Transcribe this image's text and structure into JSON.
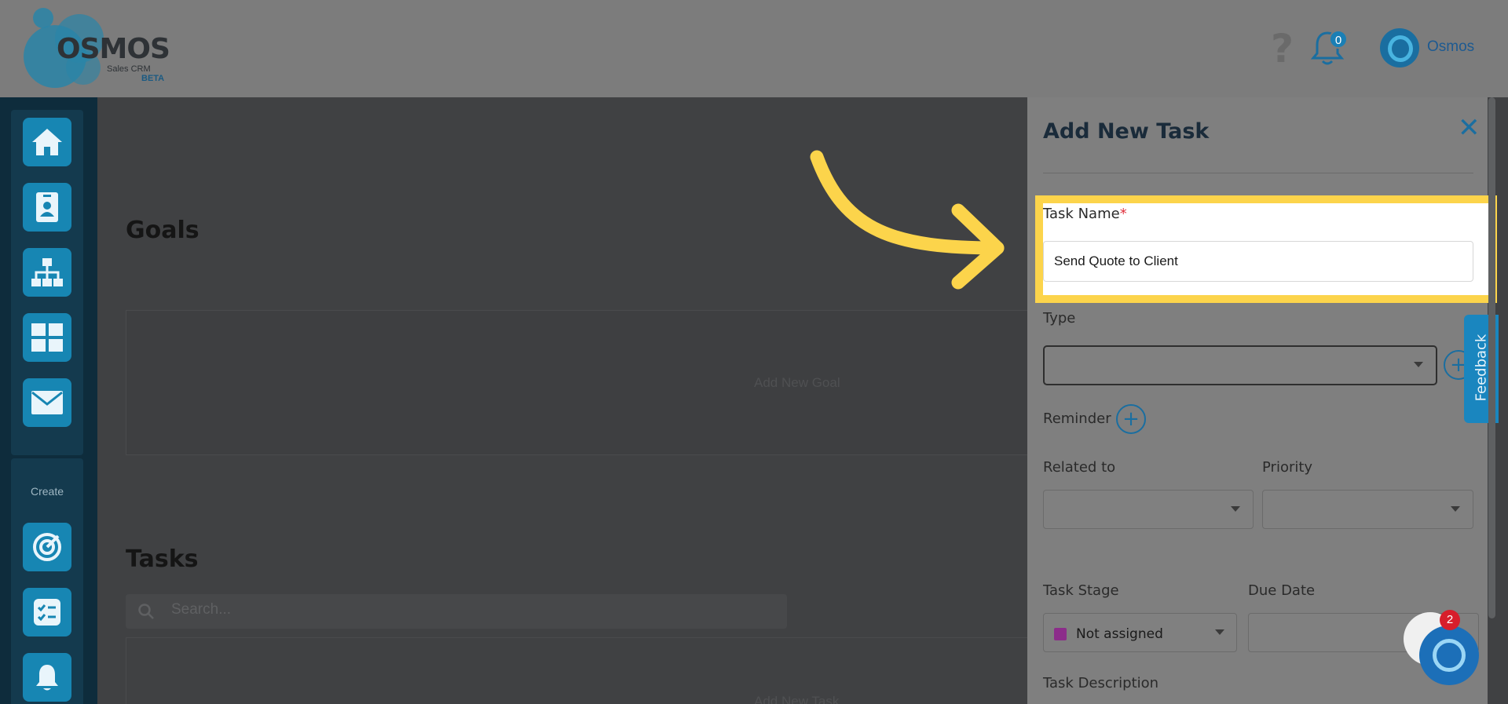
{
  "header": {
    "logo": {
      "word": "OSMOS",
      "subtitle": "Sales CRM",
      "tag": "BETA"
    },
    "notifications_count": "0",
    "user_name": "Osmos"
  },
  "sidebar": {
    "create_label": "Create",
    "top_icons": [
      "home-icon",
      "contact-card-icon",
      "org-chart-icon",
      "grid-icon",
      "mail-icon"
    ],
    "create_icons": [
      "target-icon",
      "checklist-icon",
      "bell-icon"
    ]
  },
  "main": {
    "goals_title": "Goals",
    "add_goal": "Add New Goal",
    "tasks_title": "Tasks",
    "search_placeholder": "Search...",
    "add_task": "Add New Task"
  },
  "drawer": {
    "title": "Add New Task",
    "task_name_label": "Task Name",
    "required_mark": "*",
    "task_name_value": "Send Quote to Client",
    "type_label": "Type",
    "reminder_label": "Reminder",
    "related_label": "Related to",
    "priority_label": "Priority",
    "stage_label": "Task Stage",
    "stage_value": "Not assigned",
    "stage_color": "#8c2d8a",
    "due_label": "Due Date",
    "description_label": "Task Description"
  },
  "feedback_label": "Feedback",
  "chat_badge_count": "2",
  "colors": {
    "accent": "#1786b3",
    "highlight": "#fcd44b",
    "arrow": "#fcd44b"
  }
}
